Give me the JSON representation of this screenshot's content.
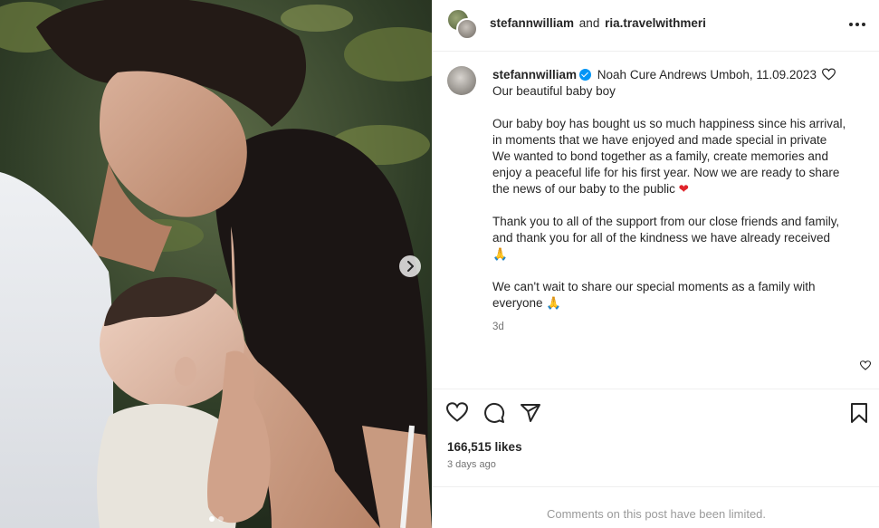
{
  "header": {
    "user1": "stefannwilliam",
    "and": "and",
    "user2": "ria.travelwithmeri"
  },
  "caption": {
    "username": "stefannwilliam",
    "line_1": "Noah Cure Andrews Umboh, 11.09.2023",
    "line_2": "Our beautiful baby boy",
    "paragraph_1": [
      "Our baby boy has bought us so much happiness since his arrival,",
      "in moments that we have enjoyed and made special in private",
      "We wanted to bond together as a family, create memories and",
      "enjoy a peaceful life for his first year. Now we are ready to share",
      "the news of our baby to the public"
    ],
    "paragraph_2": [
      "Thank you to all of the support from our close friends and family,",
      "and thank you for all of the kindness we have already received"
    ],
    "paragraph_3": [
      "We can't wait to share our special moments as a family with",
      "everyone"
    ],
    "emoji_heart": "❤",
    "emoji_pray": "🙏",
    "time_ago": "3d"
  },
  "stats": {
    "likes": "166,515 likes",
    "posted": "3 days ago"
  },
  "footer": {
    "comments_limited": "Comments on this post have been limited."
  },
  "carousel": {
    "current_index": 1,
    "total": 2
  },
  "icons": {
    "like": "heart-outline-icon",
    "comment": "comment-bubble-icon",
    "share": "paper-plane-icon",
    "save": "bookmark-icon",
    "more": "more-horizontal-icon",
    "next": "chevron-right-icon"
  },
  "colors": {
    "verified": "#0095f6",
    "text": "#262626",
    "muted": "#737373",
    "border": "#efefef"
  }
}
